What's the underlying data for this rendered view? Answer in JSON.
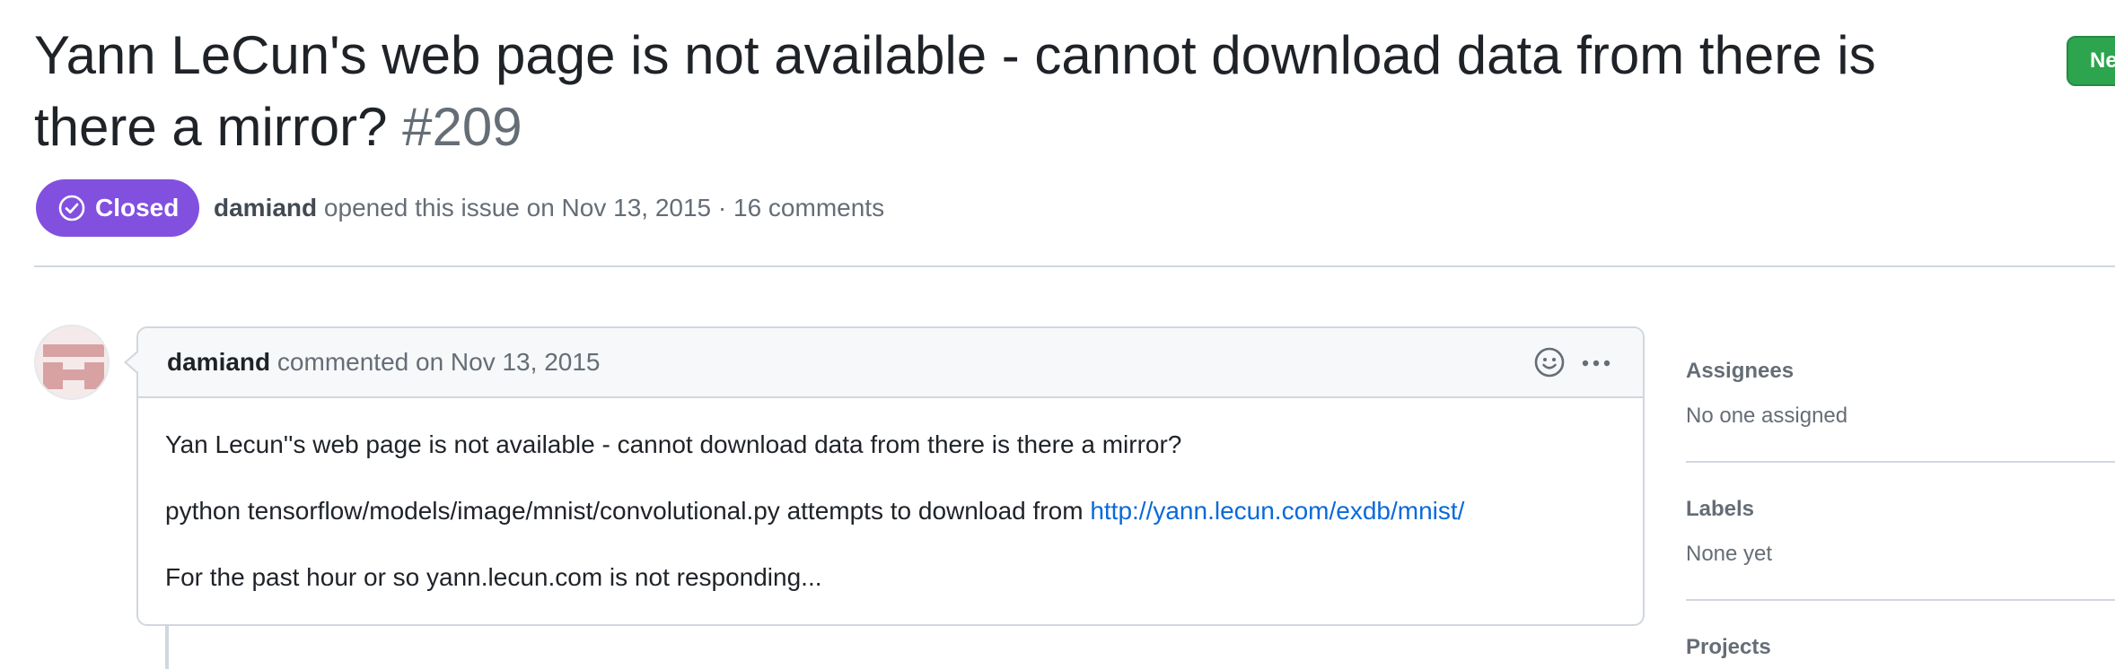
{
  "header": {
    "title": "Yann LeCun's web page is not available - cannot download data from there is there a mirror?",
    "number": "#209",
    "new_issue_label": "New issue"
  },
  "status": {
    "state": "Closed",
    "author": "damiand",
    "meta_text": "opened this issue on Nov 13, 2015 · 16 comments",
    "badge_color": "#8250df"
  },
  "comment": {
    "author": "damiand",
    "meta_text": "commented on Nov 13, 2015",
    "body": {
      "p1": "Yan Lecun''s web page is not available - cannot download data from there is there a mirror?",
      "p2_text": "python tensorflow/models/image/mnist/convolutional.py attempts to download from ",
      "p2_link": "http://yann.lecun.com/exdb/mnist/",
      "p3": "For the past hour or so yann.lecun.com is not responding..."
    },
    "icons": {
      "emoji": "smiley-icon",
      "more": "kebab-icon"
    }
  },
  "sidebar": {
    "assignees": {
      "heading": "Assignees",
      "value": "No one assigned"
    },
    "labels": {
      "heading": "Labels",
      "value": "None yet"
    },
    "projects": {
      "heading": "Projects"
    }
  },
  "colors": {
    "link": "#0969da",
    "new_issue_button": "#2da44e",
    "border": "#d0d7de"
  }
}
